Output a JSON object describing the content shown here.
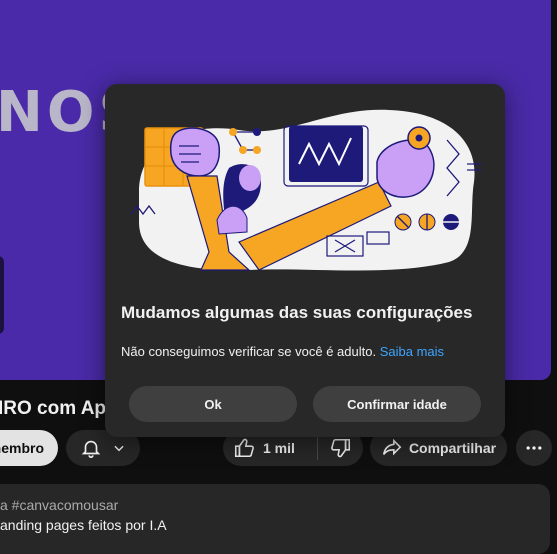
{
  "video": {
    "overlay_text": "NOST",
    "title": "IRO com Ap"
  },
  "actions": {
    "member_label": "nembro",
    "like_count": "1 mil",
    "share_label": "Compartilhar"
  },
  "description": {
    "hashtags": "a #canvacomousar",
    "line": "anding pages feitos por I.A"
  },
  "dialog": {
    "title": "Mudamos algumas das suas configurações",
    "message": "Não conseguimos verificar se você é adulto.",
    "link": "Saiba mais",
    "ok_label": "Ok",
    "confirm_label": "Confirmar idade"
  },
  "colors": {
    "video_bg": "#4a2aa8",
    "dialog_bg": "#282828",
    "link": "#3ea6ff",
    "illustration_orange": "#f6a623",
    "illustration_purple": "#c9a0f5",
    "illustration_navy": "#1d1a7a"
  },
  "icons": [
    "bell-icon",
    "chevron-down-icon",
    "like-icon",
    "dislike-icon",
    "share-icon",
    "more-icon"
  ]
}
